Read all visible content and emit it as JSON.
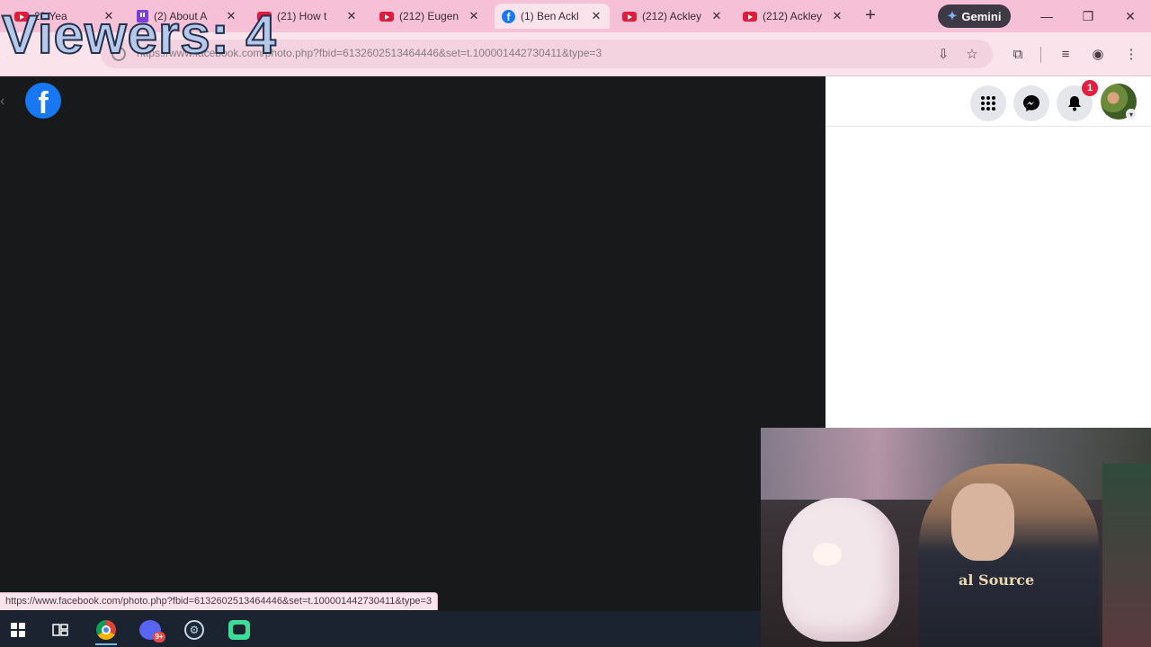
{
  "tabs": [
    {
      "title": "28 Yea",
      "icon": "youtube-icon"
    },
    {
      "title": "(2) About A",
      "icon": "twitch-icon"
    },
    {
      "title": "(21) How t",
      "icon": "youtube-icon"
    },
    {
      "title": "(212) Eugen",
      "icon": "youtube-icon"
    },
    {
      "title": "(1) Ben Ackl",
      "icon": "facebook-icon",
      "active": true
    },
    {
      "title": "(212) Ackley",
      "icon": "youtube-icon"
    },
    {
      "title": "(212) Ackley",
      "icon": "youtube-icon"
    }
  ],
  "tab_close": "✕",
  "new_tab": "+",
  "gemini_label": "Gemini",
  "window_controls": {
    "minimize": "—",
    "restore": "❐",
    "close": "✕"
  },
  "address_bar": {
    "url": "https://www.facebook.com/photo.php?fbid=6132602513464446&set=t.100001442730411&type=3"
  },
  "stream_overlay": {
    "viewers": "Viewers: 4"
  },
  "facebook": {
    "logo_letter": "f",
    "notification_count": "1"
  },
  "status_bar_url": "https://www.facebook.com/photo.php?fbid=6132602513464446&set=t.100001442730411&type=3",
  "webcam": {
    "shirt_text": "al Source"
  },
  "colors": {
    "tab_strip": "#f6c1d6",
    "toolbar": "#fbe3ec",
    "facebook_blue": "#1877f2",
    "photo_bg": "#18191a",
    "taskbar": "#1c2330"
  }
}
